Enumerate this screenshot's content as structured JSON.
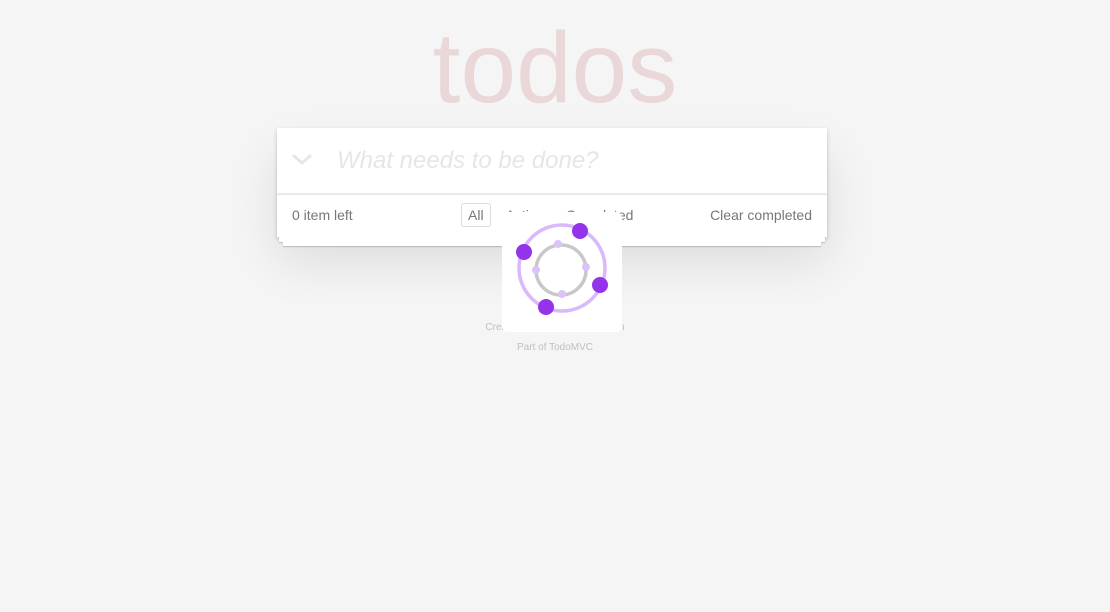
{
  "app": {
    "title": "todos"
  },
  "header": {
    "new_todo_placeholder": "What needs to be done?",
    "toggle_all_icon": "chevron-down-icon"
  },
  "footer": {
    "count_text": "0 item left",
    "filters": [
      {
        "label": "All",
        "selected": true
      },
      {
        "label": "Active",
        "selected": false
      },
      {
        "label": "Completed",
        "selected": false
      }
    ],
    "clear_completed_label": "Clear completed"
  },
  "info": {
    "line1": "Created by the TodoMVC Team",
    "line2": "Part of TodoMVC"
  },
  "overlay": {
    "icon": "loading-spinner-icon",
    "colors": {
      "outer_ring": "#d9b8fb",
      "inner_ring": "#c8c8c8",
      "dots": "#9333ea",
      "small_dots": "#dcc2fa"
    }
  },
  "colors": {
    "background": "#f5f5f5",
    "title": "#eadbdb",
    "placeholder": "#e6e6e6"
  }
}
